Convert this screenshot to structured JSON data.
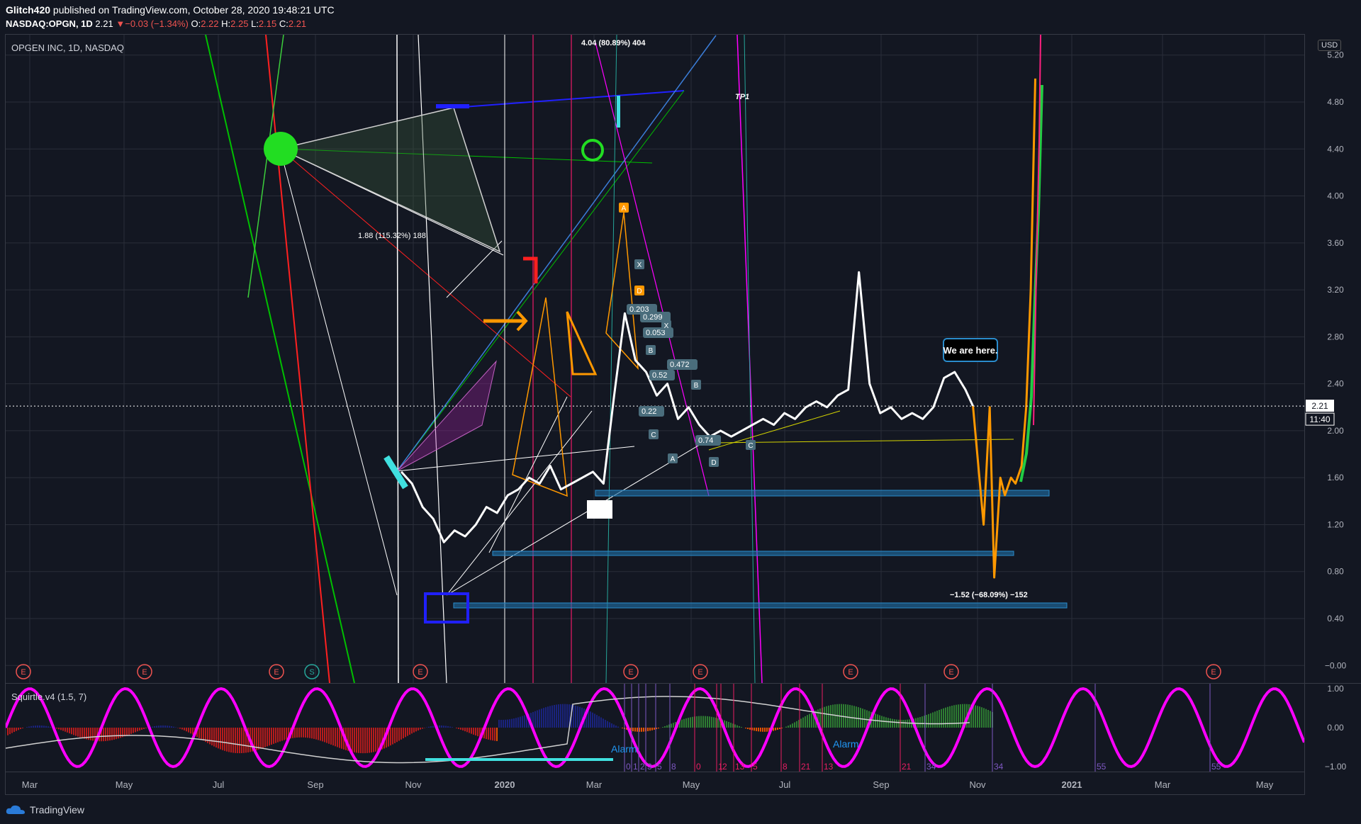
{
  "header": {
    "author": "Glitch420",
    "published": "published on TradingView.com, October 28, 2020 19:48:21 UTC",
    "symbol": "NASDAQ:OPGN, 1D",
    "last": "2.21",
    "change": "▼−0.03 (−1.34%)",
    "o_label": "O:",
    "o": "2.22",
    "h_label": "H:",
    "h": "2.25",
    "l_label": "L:",
    "l": "2.15",
    "c_label": "C:",
    "c": "2.21"
  },
  "pane_title": "OPGEN INC, 1D, NASDAQ",
  "currency": "USD",
  "indicator_title": "Squirtle.v4 (1.5, 7)",
  "brand": "TradingView",
  "colors": {
    "bg": "#131722",
    "grid": "#2a2e39",
    "up": "#26a69a",
    "down": "#ef5350",
    "price": "#ffffff",
    "sine": "#ff00ff"
  },
  "chart_data": {
    "type": "line",
    "title": "OPGEN INC, 1D, NASDAQ",
    "x_ticks": [
      "Mar",
      "May",
      "Jul",
      "Sep",
      "Nov",
      "2020",
      "Mar",
      "May",
      "Jul",
      "Sep",
      "Nov",
      "2021",
      "Mar",
      "May"
    ],
    "y_ticks": [
      "5.20",
      "4.80",
      "4.40",
      "4.00",
      "3.60",
      "3.20",
      "2.80",
      "2.40",
      "2.00",
      "1.60",
      "1.20",
      "0.80",
      "0.40",
      "−0.00"
    ],
    "ylim": [
      -0.1,
      5.3
    ],
    "last_price": "2.21",
    "countdown": "11:40",
    "series": [
      {
        "x": [
          "2019-10-18",
          "2019-10-25",
          "2019-11-01",
          "2019-11-08",
          "2019-11-15",
          "2019-11-22",
          "2019-11-29",
          "2019-12-06",
          "2019-12-13",
          "2019-12-20",
          "2019-12-27",
          "2020-01-03",
          "2020-01-10",
          "2020-01-17",
          "2020-01-24",
          "2020-01-31",
          "2020-02-07",
          "2020-02-14",
          "2020-02-21",
          "2020-02-28",
          "2020-03-06",
          "2020-03-13",
          "2020-03-20",
          "2020-03-27",
          "2020-04-03",
          "2020-04-10",
          "2020-04-17",
          "2020-04-24",
          "2020-05-01",
          "2020-05-08",
          "2020-05-15",
          "2020-05-22",
          "2020-05-29",
          "2020-06-05",
          "2020-06-12",
          "2020-06-19",
          "2020-06-26",
          "2020-07-03",
          "2020-07-10",
          "2020-07-17",
          "2020-07-24",
          "2020-07-31",
          "2020-08-07",
          "2020-08-14",
          "2020-08-21",
          "2020-08-28",
          "2020-09-04",
          "2020-09-11",
          "2020-09-18",
          "2020-09-25",
          "2020-10-02",
          "2020-10-09",
          "2020-10-16",
          "2020-10-23",
          "2020-10-28"
        ],
        "y": [
          1.65,
          1.55,
          1.35,
          1.25,
          1.05,
          1.15,
          1.1,
          1.2,
          1.35,
          1.3,
          1.45,
          1.5,
          1.6,
          1.55,
          1.7,
          1.5,
          1.55,
          1.6,
          1.65,
          1.55,
          2.3,
          3.0,
          2.6,
          2.5,
          2.3,
          2.4,
          2.1,
          2.2,
          2.05,
          1.95,
          2.0,
          1.95,
          2.0,
          2.05,
          2.1,
          2.05,
          2.15,
          2.1,
          2.2,
          2.25,
          2.2,
          2.3,
          2.35,
          3.35,
          2.4,
          2.15,
          2.2,
          2.1,
          2.15,
          2.1,
          2.2,
          2.45,
          2.5,
          2.35,
          2.21
        ]
      },
      {
        "x": [
          "2020-10-28",
          "2020-11-04",
          "2020-11-08",
          "2020-11-11",
          "2020-11-15",
          "2020-11-18",
          "2020-11-22",
          "2020-11-25",
          "2020-11-29",
          "2020-12-02",
          "2020-12-05",
          "2020-12-08"
        ],
        "y": [
          2.21,
          1.2,
          2.2,
          0.75,
          1.6,
          1.45,
          1.6,
          1.55,
          1.7,
          2.2,
          3.2,
          5.0
        ]
      }
    ],
    "annotations": [
      "4.04 (80.89%) 404",
      "1.88 (115.32%) 188",
      "TP1",
      "We are here.",
      "−1.52 (−68.09%) −152",
      "Alarm",
      "Alarm"
    ],
    "fib_labels": [
      "0.203",
      "0.299",
      "0.053",
      "0.472",
      "0.52",
      "0.74",
      "0.22"
    ],
    "pattern_points": [
      "A",
      "X",
      "D",
      "B",
      "C",
      "X",
      "B",
      "A",
      "D",
      "C"
    ],
    "indicator_ticks": [
      "1.00",
      "0.00",
      "−1.00"
    ],
    "indicator_counts": [
      "0",
      "1",
      "2",
      "3",
      "5",
      "8",
      "0",
      "1",
      "2",
      "13",
      "5",
      "8",
      "21",
      "13",
      "21",
      "34",
      "34",
      "55",
      "55"
    ],
    "earnings_markers": [
      "E",
      "E",
      "E",
      "S",
      "E",
      "E",
      "E",
      "E",
      "E",
      "E"
    ]
  }
}
